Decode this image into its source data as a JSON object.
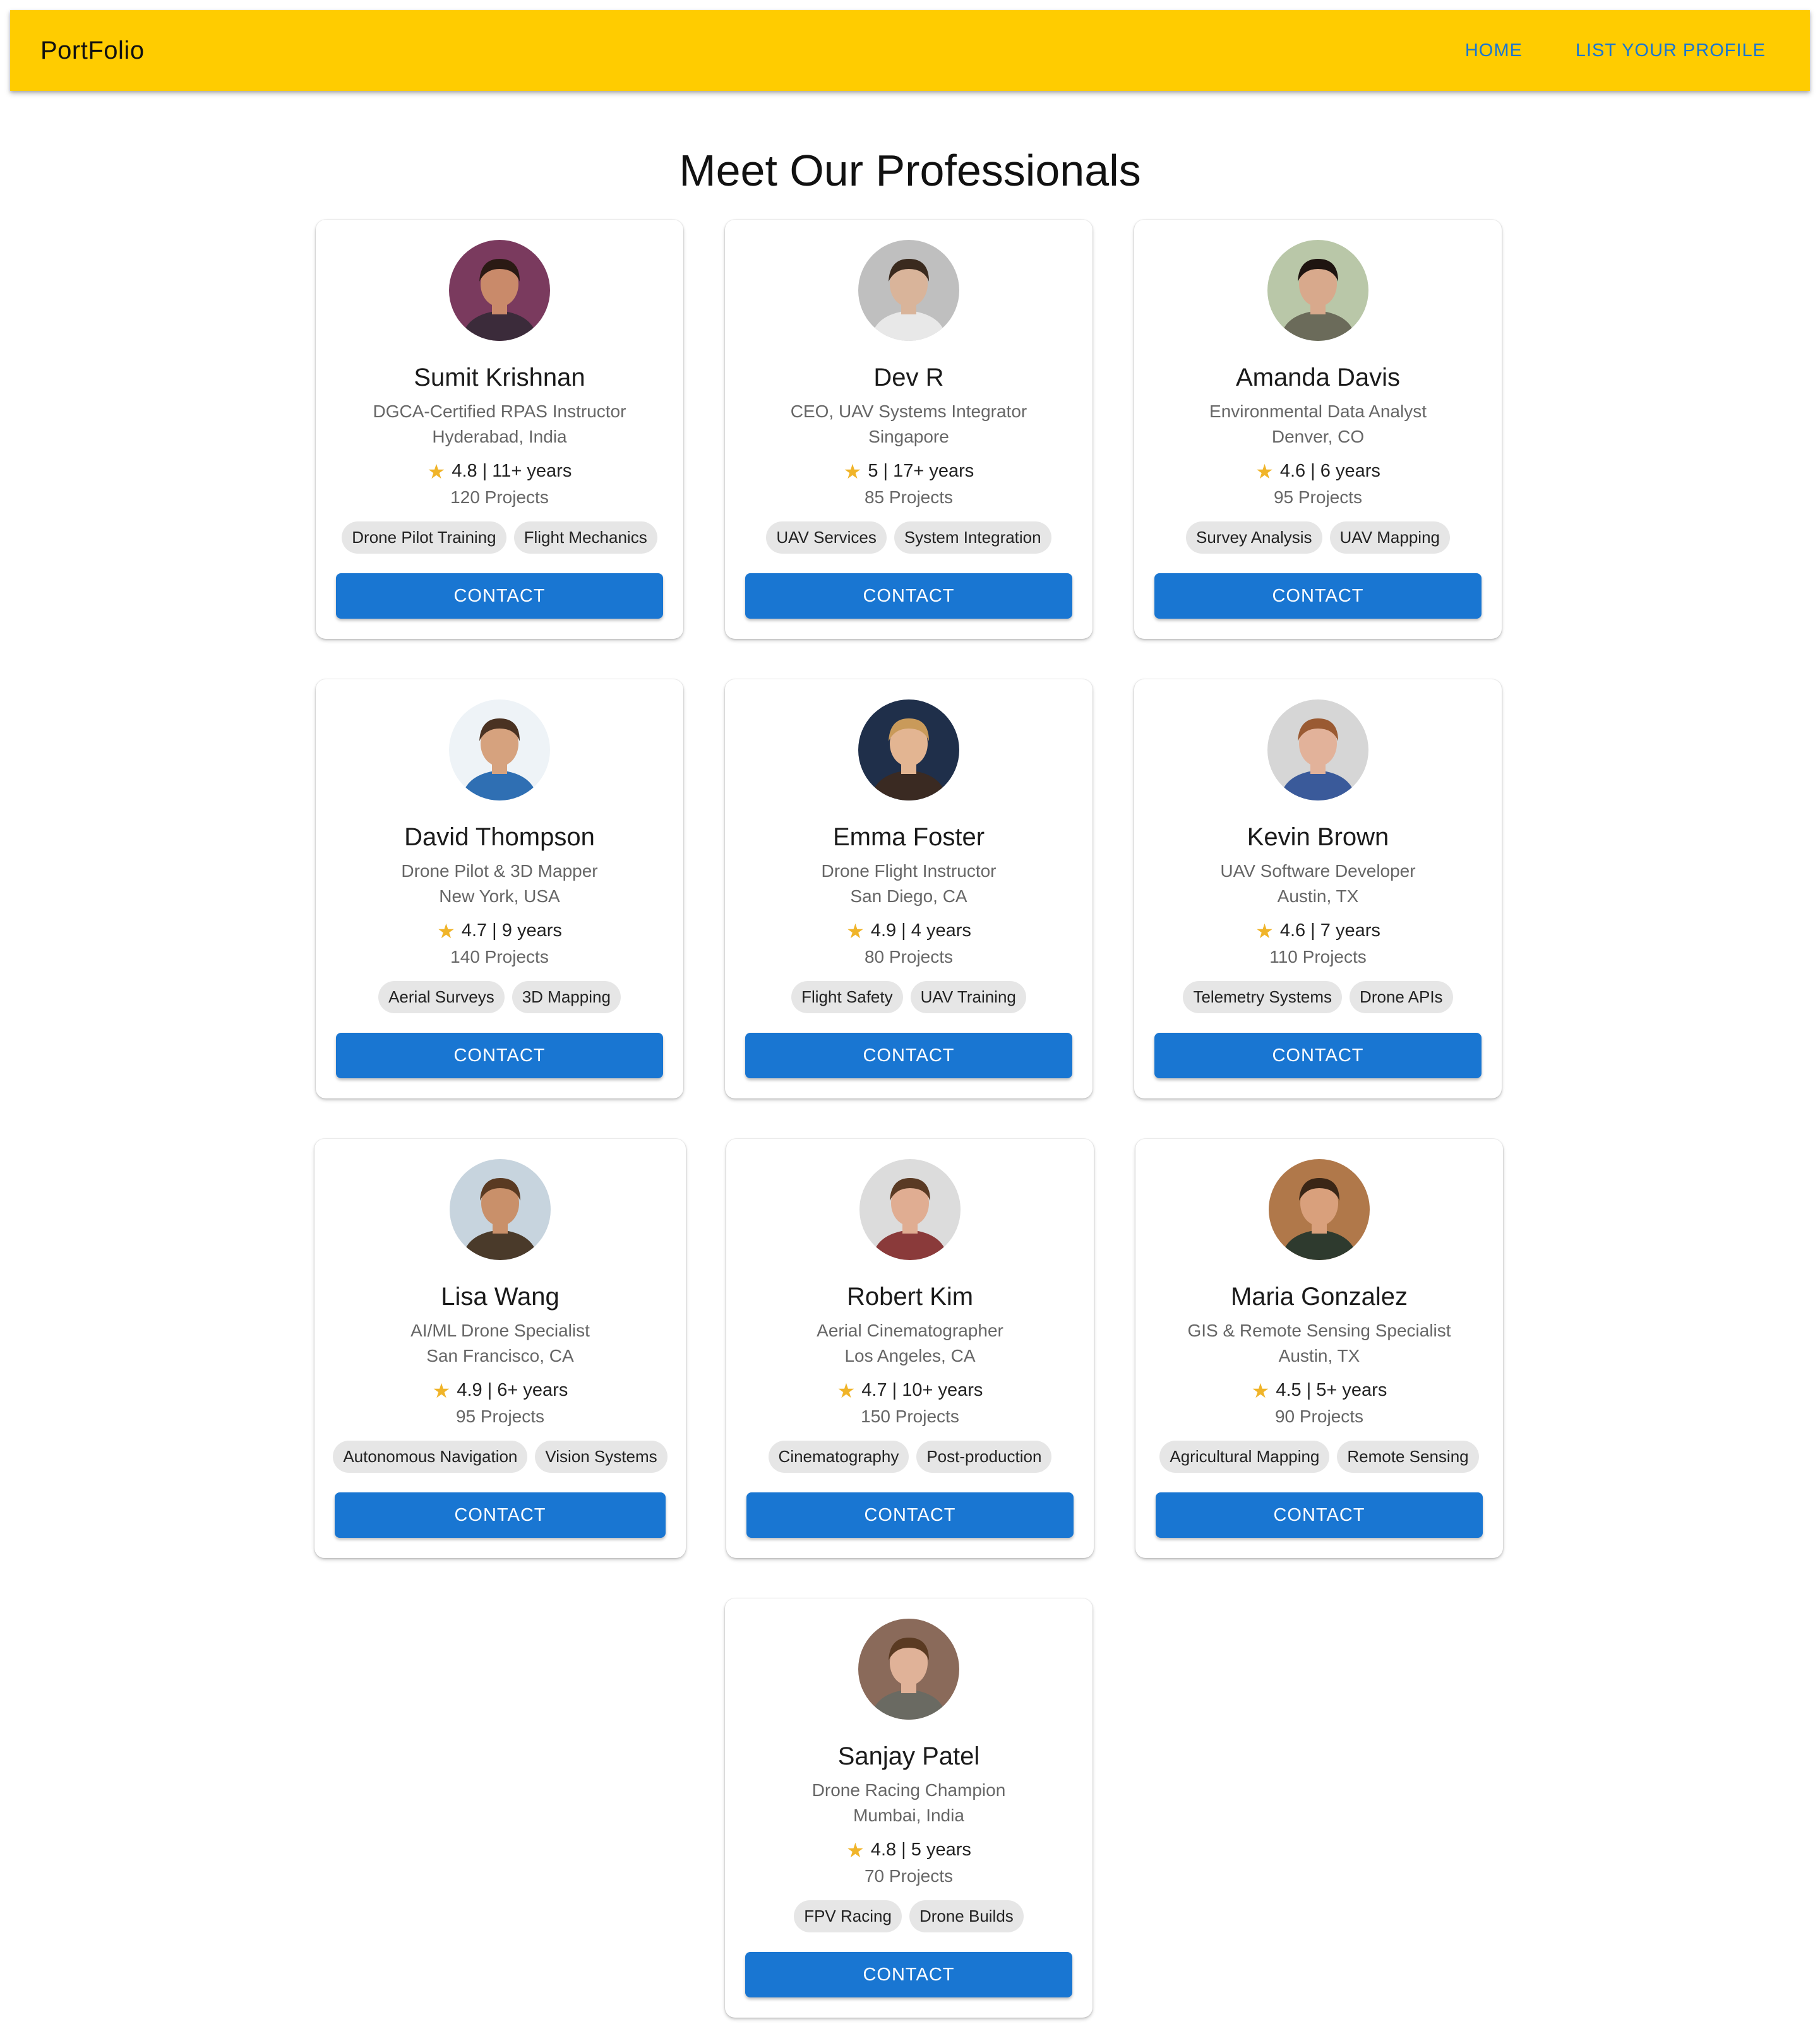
{
  "appbar": {
    "brand": "PortFolio",
    "nav": [
      {
        "label": "HOME"
      },
      {
        "label": "LIST YOUR PROFILE"
      }
    ]
  },
  "page": {
    "title": "Meet Our Professionals"
  },
  "colors": {
    "appbar": "#ffcc00",
    "accent": "#1976d2",
    "star": "#f0b429",
    "tag_bg": "#e6e6e6"
  },
  "professionals": [
    {
      "name": "Sumit Krishnan",
      "role": "DGCA-Certified RPAS Instructor",
      "location": "Hyderabad, India",
      "rating_line": "4.8 | 11+ years",
      "projects": "120 Projects",
      "tags": [
        "Drone Pilot Training",
        "Flight Mechanics"
      ],
      "contact_label": "CONTACT",
      "avatar": {
        "bg": "#7a3a5e",
        "skin": "#c98a6a",
        "hair": "#2a1a14",
        "shirt": "#3b2b3a"
      }
    },
    {
      "name": "Dev R",
      "role": "CEO, UAV Systems Integrator",
      "location": "Singapore",
      "rating_line": "5 | 17+ years",
      "projects": "85 Projects",
      "tags": [
        "UAV Services",
        "System Integration"
      ],
      "contact_label": "CONTACT",
      "avatar": {
        "bg": "#bfbfbf",
        "skin": "#d9b49a",
        "hair": "#3a2a1e",
        "shirt": "#e8e8e8"
      }
    },
    {
      "name": "Amanda Davis",
      "role": "Environmental Data Analyst",
      "location": "Denver, CO",
      "rating_line": "4.6 | 6 years",
      "projects": "95 Projects",
      "tags": [
        "Survey Analysis",
        "UAV Mapping"
      ],
      "contact_label": "CONTACT",
      "avatar": {
        "bg": "#b9c7a8",
        "skin": "#d8a98c",
        "hair": "#1e1410",
        "shirt": "#6b6b5a"
      }
    },
    {
      "name": "David Thompson",
      "role": "Drone Pilot & 3D Mapper",
      "location": "New York, USA",
      "rating_line": "4.7 | 9 years",
      "projects": "140 Projects",
      "tags": [
        "Aerial Surveys",
        "3D Mapping"
      ],
      "contact_label": "CONTACT",
      "avatar": {
        "bg": "#eef3f7",
        "skin": "#d6a27e",
        "hair": "#4a3222",
        "shirt": "#2f6fb3"
      }
    },
    {
      "name": "Emma Foster",
      "role": "Drone Flight Instructor",
      "location": "San Diego, CA",
      "rating_line": "4.9 | 4 years",
      "projects": "80 Projects",
      "tags": [
        "Flight Safety",
        "UAV Training"
      ],
      "contact_label": "CONTACT",
      "avatar": {
        "bg": "#1f2f4a",
        "skin": "#e3b592",
        "hair": "#c99a5a",
        "shirt": "#3a2a22"
      }
    },
    {
      "name": "Kevin Brown",
      "role": "UAV Software Developer",
      "location": "Austin, TX",
      "rating_line": "4.6 | 7 years",
      "projects": "110 Projects",
      "tags": [
        "Telemetry Systems",
        "Drone APIs"
      ],
      "contact_label": "CONTACT",
      "avatar": {
        "bg": "#d6d6d6",
        "skin": "#e2b29a",
        "hair": "#9a5a32",
        "shirt": "#3a5a9a"
      }
    },
    {
      "name": "Lisa Wang",
      "role": "AI/ML Drone Specialist",
      "location": "San Francisco, CA",
      "rating_line": "4.9 | 6+ years",
      "projects": "95 Projects",
      "tags": [
        "Autonomous Navigation",
        "Vision Systems"
      ],
      "contact_label": "CONTACT",
      "avatar": {
        "bg": "#c7d4de",
        "skin": "#c9906a",
        "hair": "#5a3a22",
        "shirt": "#4a3a2a"
      }
    },
    {
      "name": "Robert Kim",
      "role": "Aerial Cinematographer",
      "location": "Los Angeles, CA",
      "rating_line": "4.7 | 10+ years",
      "projects": "150 Projects",
      "tags": [
        "Cinematography",
        "Post-production"
      ],
      "contact_label": "CONTACT",
      "avatar": {
        "bg": "#dcdcdc",
        "skin": "#e0ad92",
        "hair": "#5a3a24",
        "shirt": "#8a3a3a"
      }
    },
    {
      "name": "Maria Gonzalez",
      "role": "GIS & Remote Sensing Specialist",
      "location": "Austin, TX",
      "rating_line": "4.5 | 5+ years",
      "projects": "90 Projects",
      "tags": [
        "Agricultural Mapping",
        "Remote Sensing"
      ],
      "contact_label": "CONTACT",
      "avatar": {
        "bg": "#b0784a",
        "skin": "#d9a07c",
        "hair": "#3a2616",
        "shirt": "#2e3a2e"
      }
    },
    {
      "name": "Sanjay Patel",
      "role": "Drone Racing Champion",
      "location": "Mumbai, India",
      "rating_line": "4.8 | 5 years",
      "projects": "70 Projects",
      "tags": [
        "FPV Racing",
        "Drone Builds"
      ],
      "contact_label": "CONTACT",
      "avatar": {
        "bg": "#8a6a5a",
        "skin": "#e0b298",
        "hair": "#5a3a22",
        "shirt": "#6a6a62"
      }
    }
  ]
}
